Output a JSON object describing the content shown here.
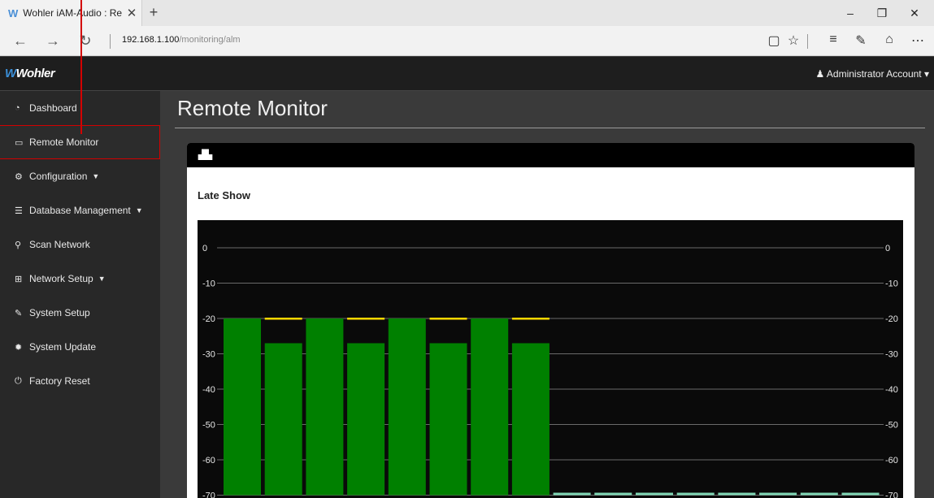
{
  "browser": {
    "tab_title": "Wohler iAM-Audio : Rer",
    "tab_close": "✕",
    "new_tab": "+",
    "url_host": "192.168.1.100",
    "url_path": "/monitoring/alm",
    "icons": [
      "back-icon",
      "forward-icon",
      "refresh-icon",
      "reading-view-icon",
      "favorite-star-icon",
      "hub-icon",
      "web-note-icon",
      "share-icon",
      "more-icon"
    ]
  },
  "app": {
    "logo": "Wohler",
    "account": "Administrator Account"
  },
  "sidebar": {
    "items": [
      {
        "label": "Dashboard",
        "icon": "dashboard-icon",
        "caret": false
      },
      {
        "label": "Remote Monitor",
        "icon": "monitor-icon",
        "caret": false,
        "active": true
      },
      {
        "label": "Configuration",
        "icon": "cogs-icon",
        "caret": true
      },
      {
        "label": "Database Management",
        "icon": "database-icon",
        "caret": true
      },
      {
        "label": "Scan Network",
        "icon": "search-icon",
        "caret": false
      },
      {
        "label": "Network Setup",
        "icon": "sitemap-icon",
        "caret": true
      },
      {
        "label": "System Setup",
        "icon": "wrench-icon",
        "caret": false
      },
      {
        "label": "System Update",
        "icon": "gear-icon",
        "caret": false
      },
      {
        "label": "Factory Reset",
        "icon": "power-icon",
        "caret": false
      }
    ]
  },
  "main": {
    "page_title": "Remote Monitor",
    "source_title": "Late Show"
  },
  "colors": {
    "green": "#008000",
    "yellow": "#ffd700",
    "inactive": "#7fd6b4",
    "highlight": "#d40000"
  },
  "chart_data": {
    "type": "bar",
    "y_ticks": [
      0,
      -10,
      -20,
      -30,
      -40,
      -50,
      -60,
      -70
    ],
    "ylim": [
      -70,
      0
    ],
    "green_top": -30,
    "channels": [
      {
        "level": -20,
        "peak": null
      },
      {
        "level": -27,
        "peak": -20
      },
      {
        "level": -20,
        "peak": null
      },
      {
        "level": -27,
        "peak": -20
      },
      {
        "level": -20,
        "peak": null
      },
      {
        "level": -27,
        "peak": -20
      },
      {
        "level": -20,
        "peak": null
      },
      {
        "level": -27,
        "peak": -20
      },
      {
        "level": null,
        "peak": null
      },
      {
        "level": null,
        "peak": null
      },
      {
        "level": null,
        "peak": null
      },
      {
        "level": null,
        "peak": null
      },
      {
        "level": null,
        "peak": null
      },
      {
        "level": null,
        "peak": null
      },
      {
        "level": null,
        "peak": null
      },
      {
        "level": null,
        "peak": null
      }
    ]
  }
}
